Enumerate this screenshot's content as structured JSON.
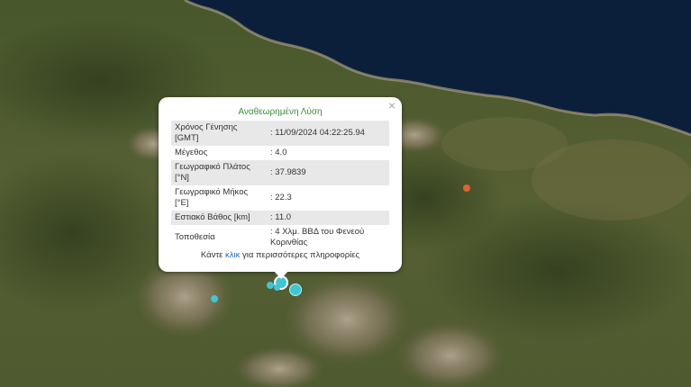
{
  "popup": {
    "title": "Αναθεωρημένη Λύση",
    "rows": [
      {
        "label": "Χρόνος Γένησης [GMT]",
        "value": ": 11/09/2024 04:22:25.94"
      },
      {
        "label": "Μέγεθος",
        "value": ": 4.0"
      },
      {
        "label": "Γεωγραφικό Πλάτος [°N]",
        "value": ": 37.9839"
      },
      {
        "label": "Γεωγραφικό Μήκος [°E]",
        "value": ": 22.3"
      },
      {
        "label": "Εστιακό Βάθος [km]",
        "value": ": 11.0"
      },
      {
        "label": "Τοποθεσία",
        "value": ": 4 Χλμ. ΒΒΔ του Φενεού Κορινθίας"
      }
    ],
    "footer_prefix": "Κάντε ",
    "footer_link": "κλικ",
    "footer_suffix": " για περισσότερες πληροφορίες",
    "close_glyph": "×"
  },
  "colors": {
    "sea": "#0b1f3a",
    "land": "#4a5a2c",
    "mountain": "#8a7a68",
    "marker_cyan": "#3fc6d4",
    "marker_orange": "#d9662c",
    "title_green": "#3d8f3d",
    "link_blue": "#1a6fc9"
  },
  "markers": [
    {
      "type": "cyan",
      "size": "large"
    },
    {
      "type": "cyan",
      "size": "large"
    },
    {
      "type": "cyan",
      "size": "small"
    },
    {
      "type": "cyan",
      "size": "small"
    },
    {
      "type": "cyan",
      "size": "small"
    },
    {
      "type": "orange",
      "size": "small"
    }
  ]
}
